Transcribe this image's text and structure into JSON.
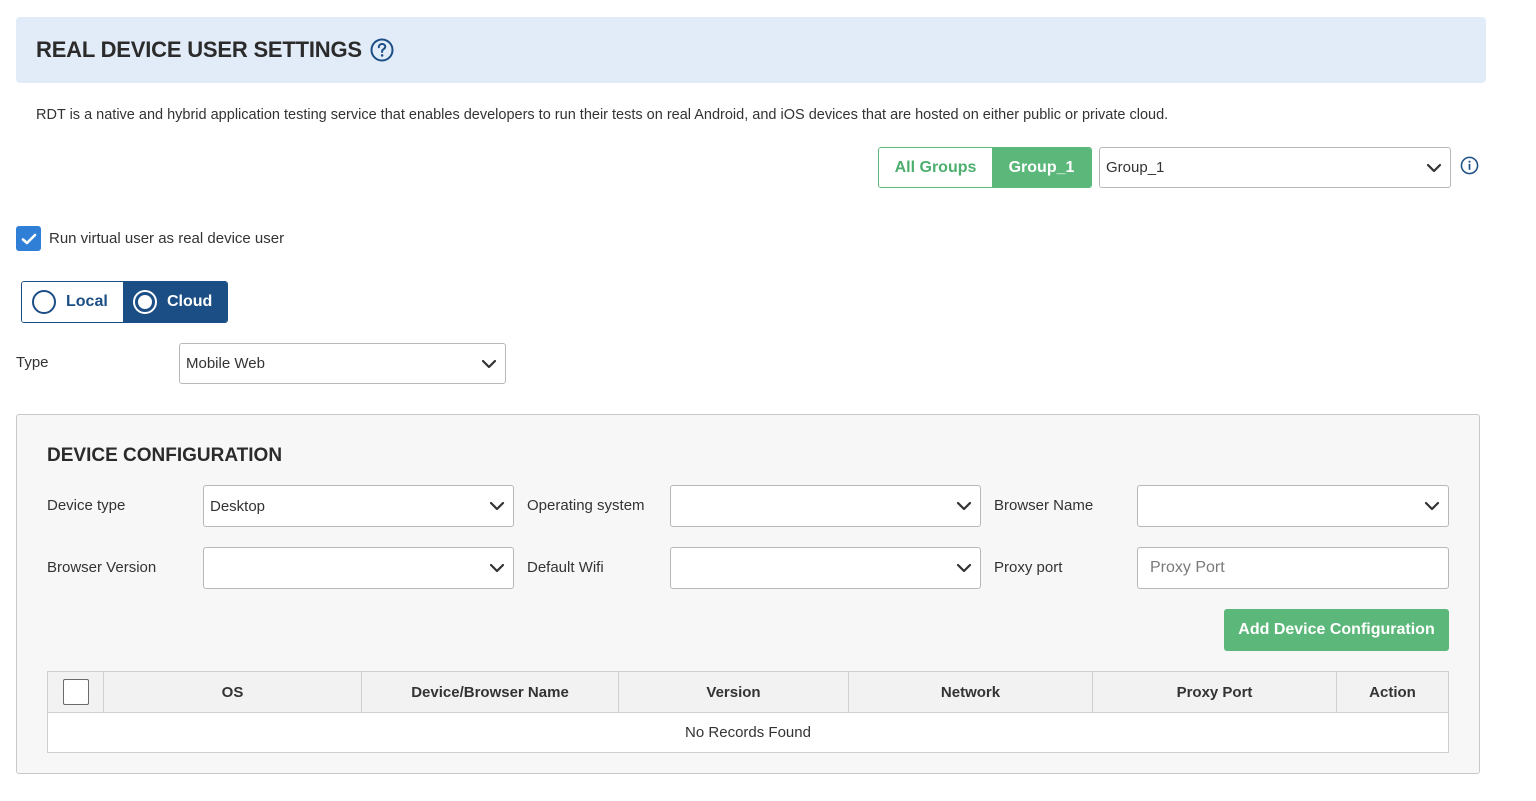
{
  "header": {
    "title": "REAL DEVICE USER SETTINGS",
    "help_icon": "question-circle-icon"
  },
  "description": "RDT is a native and hybrid application testing service that enables developers to run their tests on real Android, and iOS devices that are hosted on either public or private cloud.",
  "group_toggle": {
    "all_groups_label": "All Groups",
    "group_label": "Group_1",
    "selected": "Group_1"
  },
  "group_select": {
    "value": "Group_1"
  },
  "info_icon": "info-circle-icon",
  "run_virtual_user": {
    "label": "Run virtual user as real device user",
    "checked": true
  },
  "location": {
    "local_label": "Local",
    "cloud_label": "Cloud",
    "selected": "Cloud"
  },
  "type": {
    "label": "Type",
    "value": "Mobile Web"
  },
  "device_config": {
    "title": "DEVICE CONFIGURATION",
    "device_type": {
      "label": "Device type",
      "value": "Desktop"
    },
    "operating_system": {
      "label": "Operating system",
      "value": ""
    },
    "browser_name": {
      "label": "Browser Name",
      "value": ""
    },
    "browser_version": {
      "label": "Browser Version",
      "value": ""
    },
    "default_wifi": {
      "label": "Default Wifi",
      "value": ""
    },
    "proxy_port": {
      "label": "Proxy port",
      "value": "",
      "placeholder": "Proxy Port"
    },
    "add_button_label": "Add Device Configuration"
  },
  "table": {
    "columns": [
      "OS",
      "Device/Browser Name",
      "Version",
      "Network",
      "Proxy Port",
      "Action"
    ],
    "empty_message": "No Records Found"
  },
  "colors": {
    "header_bg": "#e2ecf8",
    "accent_green": "#5cb87a",
    "accent_navy": "#1c4e86",
    "checkbox_blue": "#2f7fd6"
  }
}
